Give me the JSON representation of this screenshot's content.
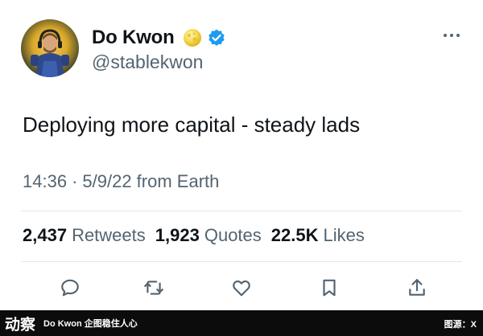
{
  "user": {
    "display_name": "Do Kwon",
    "handle": "@stablekwon"
  },
  "tweet": {
    "text": "Deploying more capital - steady lads",
    "time": "14:36",
    "separator": "·",
    "date_source": "5/9/22 from Earth"
  },
  "stats": {
    "retweets_count": "2,437",
    "retweets_label": "Retweets",
    "quotes_count": "1,923",
    "quotes_label": "Quotes",
    "likes_count": "22.5K",
    "likes_label": "Likes"
  },
  "actions": [
    "reply-icon",
    "retweet-icon",
    "like-icon",
    "bookmark-icon",
    "share-icon"
  ],
  "footer": {
    "logo": "动察",
    "caption": "Do Kwon 企图稳住人心",
    "source": "图源：X"
  },
  "colors": {
    "text_primary": "#0f1419",
    "text_secondary": "#536471",
    "verified_blue": "#1d9bf0",
    "footer_bg": "#0c0c0c"
  }
}
